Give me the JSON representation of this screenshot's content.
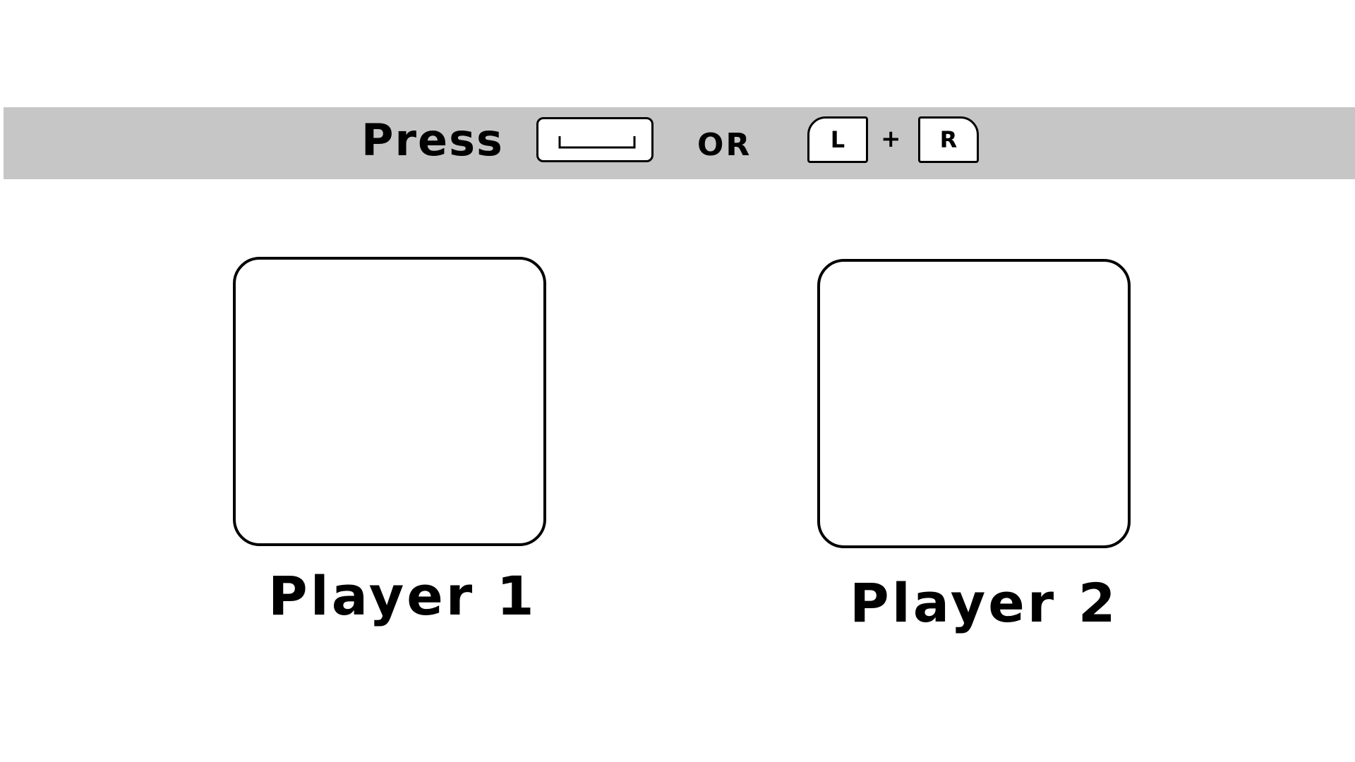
{
  "banner": {
    "press_label": "Press",
    "or_label": "OR",
    "plus_label": "+",
    "left_shoulder_label": "L",
    "right_shoulder_label": "R",
    "spacebar_icon": "spacebar-icon",
    "background_color": "#c6c6c6"
  },
  "players": [
    {
      "label": "Player 1"
    },
    {
      "label": "Player 2"
    }
  ]
}
